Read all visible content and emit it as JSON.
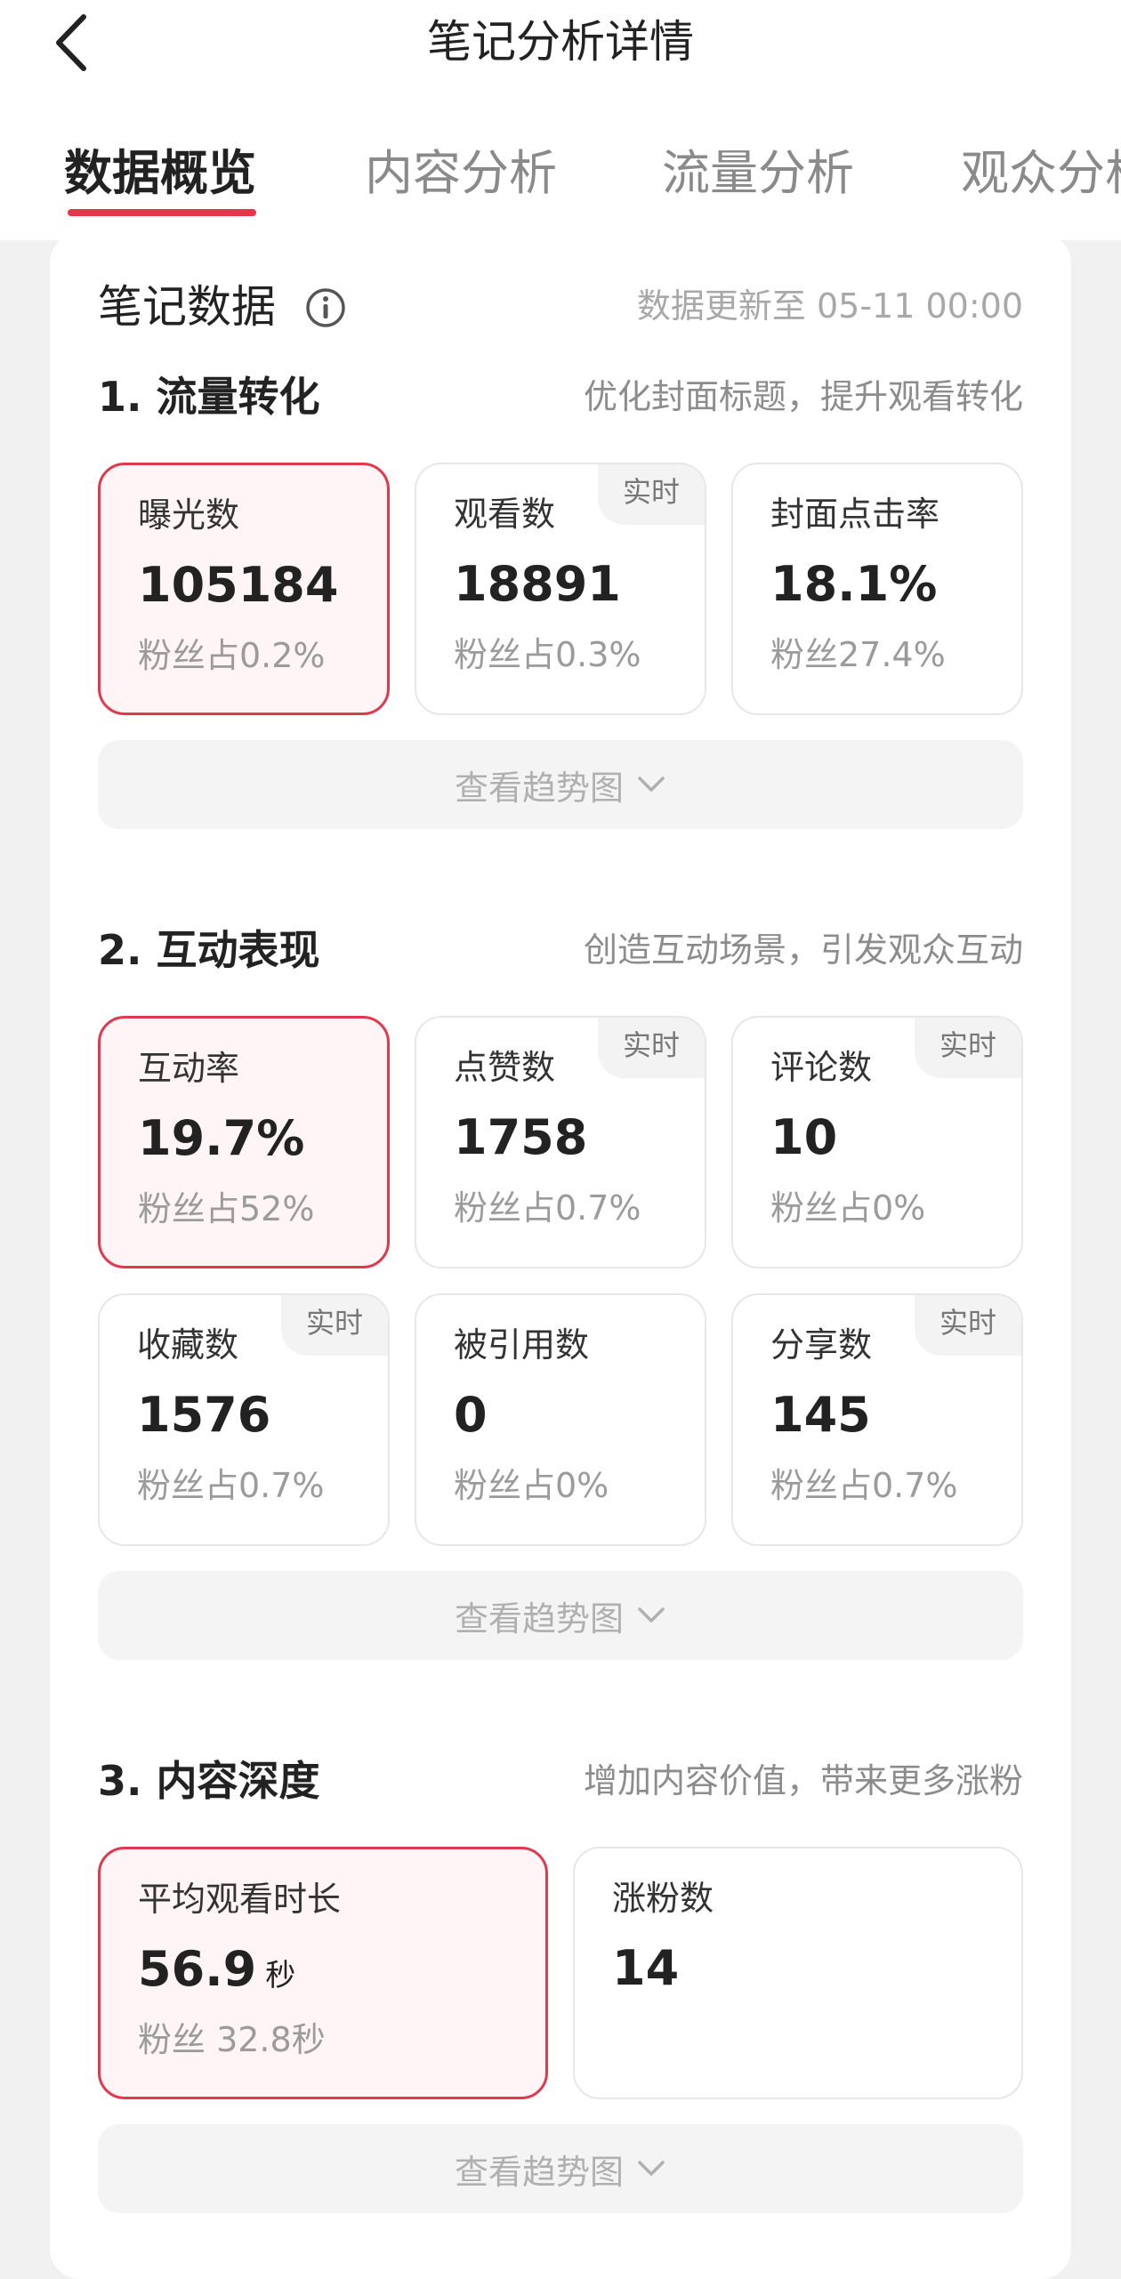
{
  "header": {
    "back_icon": "chevron-left-icon",
    "title": "笔记分析详情"
  },
  "tabs": [
    {
      "label": "数据概览",
      "active": true
    },
    {
      "label": "内容分析",
      "active": false
    },
    {
      "label": "流量分析",
      "active": false
    },
    {
      "label": "观众分析",
      "active": false
    }
  ],
  "card": {
    "title": "笔记数据",
    "info_icon": "info-icon",
    "update_text": "数据更新至 05-11 00:00"
  },
  "sections": [
    {
      "title": "1. 流量转化",
      "hint": "优化封面标题，提升观看转化",
      "metrics": [
        {
          "label": "曝光数",
          "value": "105184",
          "sub": "粉丝占0.2%",
          "highlight": true
        },
        {
          "label": "观看数",
          "value": "18891",
          "sub": "粉丝占0.3%",
          "badge": "实时"
        },
        {
          "label": "封面点击率",
          "value": "18.1%",
          "sub": "粉丝27.4%"
        }
      ],
      "trend_label": "查看趋势图"
    },
    {
      "title": "2. 互动表现",
      "hint": "创造互动场景，引发观众互动",
      "metrics": [
        {
          "label": "互动率",
          "value": "19.7%",
          "sub": "粉丝占52%",
          "highlight": true
        },
        {
          "label": "点赞数",
          "value": "1758",
          "sub": "粉丝占0.7%",
          "badge": "实时"
        },
        {
          "label": "评论数",
          "value": "10",
          "sub": "粉丝占0%",
          "badge": "实时"
        },
        {
          "label": "收藏数",
          "value": "1576",
          "sub": "粉丝占0.7%",
          "badge": "实时"
        },
        {
          "label": "被引用数",
          "value": "0",
          "sub": "粉丝占0%"
        },
        {
          "label": "分享数",
          "value": "145",
          "sub": "粉丝占0.7%",
          "badge": "实时"
        }
      ],
      "trend_label": "查看趋势图"
    },
    {
      "title": "3. 内容深度",
      "hint": "增加内容价值，带来更多涨粉",
      "metrics": [
        {
          "label": "平均观看时长",
          "value": "56.9",
          "unit": "秒",
          "sub": "粉丝 32.8秒",
          "highlight": true
        },
        {
          "label": "涨粉数",
          "value": "14"
        }
      ],
      "trend_label": "查看趋势图"
    }
  ],
  "colors": {
    "accent": "#e5354b",
    "highlight_bg": "#fff5f6",
    "page_bg": "#f1f1f1"
  }
}
